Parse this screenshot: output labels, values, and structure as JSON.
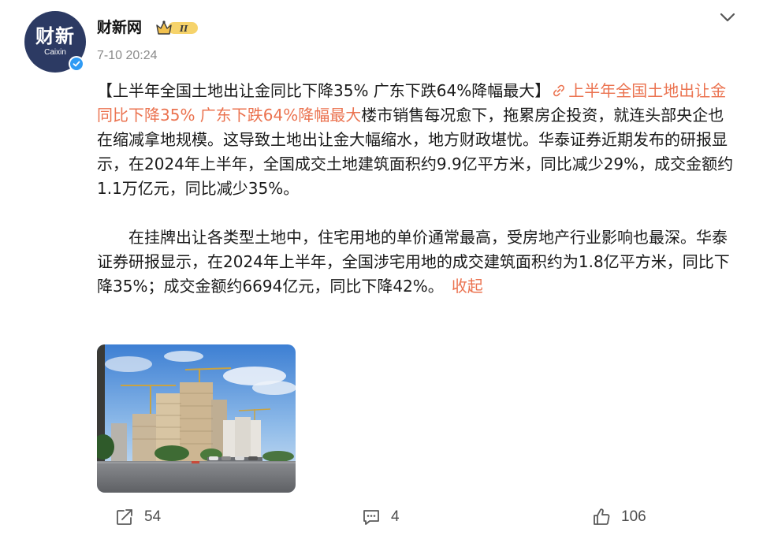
{
  "author": {
    "name": "财新网",
    "avatar_text": "财新",
    "avatar_subtext": "Caixin",
    "badge_roman": "II",
    "verified": true,
    "timestamp": "7-10 20:24"
  },
  "post": {
    "headline": "【上半年全国土地出让金同比下降35% 广东下跌64%降幅最大】",
    "link_text": "上半年全国土地出让金同比下降35% 广东下跌64%降幅最大",
    "body1": "楼市销售每况愈下，拖累房企投资，就连头部央企也在缩减拿地规模。这导致土地出让金大幅缩水，地方财政堪忧。华泰证券近期发布的研报显示，在2024年上半年，全国成交土地建筑面积约9.9亿平方米，同比减少29%，成交金额约1.1万亿元，同比减少35%。",
    "body2": "在挂牌出让各类型土地中，住宅用地的单价通常最高，受房地产行业影响也最深。华泰证券研报显示，在2024年上半年，全国涉宅用地的成交建筑面积约为1.8亿平方米，同比下降35%；成交金额约6694亿元，同比下降42%。",
    "collapse_label": "收起"
  },
  "actions": {
    "repost_count": "54",
    "comment_count": "4",
    "like_count": "106"
  },
  "colors": {
    "link": "#eb7350",
    "avatar_bg": "#2c3a63",
    "verified": "#2f9bf4",
    "badge": "#f2c14e"
  },
  "icons": [
    "verified-icon",
    "crown-badge-icon",
    "chevron-down-icon",
    "link-icon",
    "repost-icon",
    "comment-icon",
    "like-icon"
  ]
}
